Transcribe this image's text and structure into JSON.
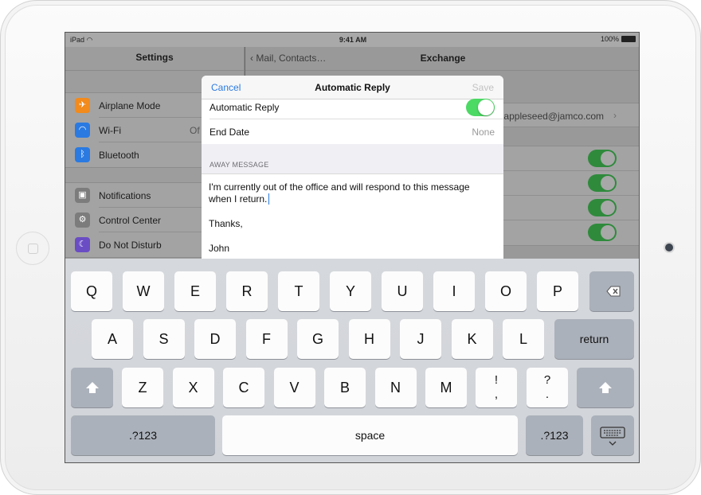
{
  "status_bar": {
    "carrier": "iPad",
    "time": "9:41 AM",
    "battery": "100%"
  },
  "settings_sidebar": {
    "title": "Settings",
    "group1": [
      {
        "label": "Airplane Mode",
        "icon": "airplane-icon",
        "color": "#f28a1c",
        "glyph": "✈",
        "value": ""
      },
      {
        "label": "Wi-Fi",
        "icon": "wifi-icon",
        "color": "#2a7ae2",
        "glyph": "◠",
        "value": "Of"
      },
      {
        "label": "Bluetooth",
        "icon": "bluetooth-icon",
        "color": "#2a7ae2",
        "glyph": "ᛒ",
        "value": ""
      }
    ],
    "group2": [
      {
        "label": "Notifications",
        "icon": "notifications-icon",
        "color": "#7c7c7c",
        "glyph": "▣"
      },
      {
        "label": "Control Center",
        "icon": "control-center-icon",
        "color": "#7c7c7c",
        "glyph": "⚙"
      },
      {
        "label": "Do Not Disturb",
        "icon": "moon-icon",
        "color": "#6a4dc4",
        "glyph": "☾"
      }
    ]
  },
  "detail": {
    "back_label": "Mail, Contacts…",
    "title": "Exchange",
    "account_email": "appleseed@jamco.com"
  },
  "modal": {
    "cancel_label": "Cancel",
    "title": "Automatic Reply",
    "save_label": "Save",
    "auto_reply_label": "Automatic Reply",
    "auto_reply_on": true,
    "end_date_label": "End Date",
    "end_date_value": "None",
    "section_header": "AWAY MESSAGE",
    "message_line1": "I'm currently out of the office and will respond to this message",
    "message_line2": "when I return.",
    "message_line3": "Thanks,",
    "message_line4": "John"
  },
  "keyboard": {
    "row1": [
      "Q",
      "W",
      "E",
      "R",
      "T",
      "Y",
      "U",
      "I",
      "O",
      "P"
    ],
    "row2": [
      "A",
      "S",
      "D",
      "F",
      "G",
      "H",
      "J",
      "K",
      "L"
    ],
    "return_label": "return",
    "row3": [
      "Z",
      "X",
      "C",
      "V",
      "B",
      "N",
      "M"
    ],
    "punct1_top": "!",
    "punct1_bottom": ",",
    "punct2_top": "?",
    "punct2_bottom": ".",
    "numbers_label": ".?123",
    "space_label": "space"
  },
  "colors": {
    "accent": "#2a7ae2",
    "toggle_on": "#4cd964"
  }
}
